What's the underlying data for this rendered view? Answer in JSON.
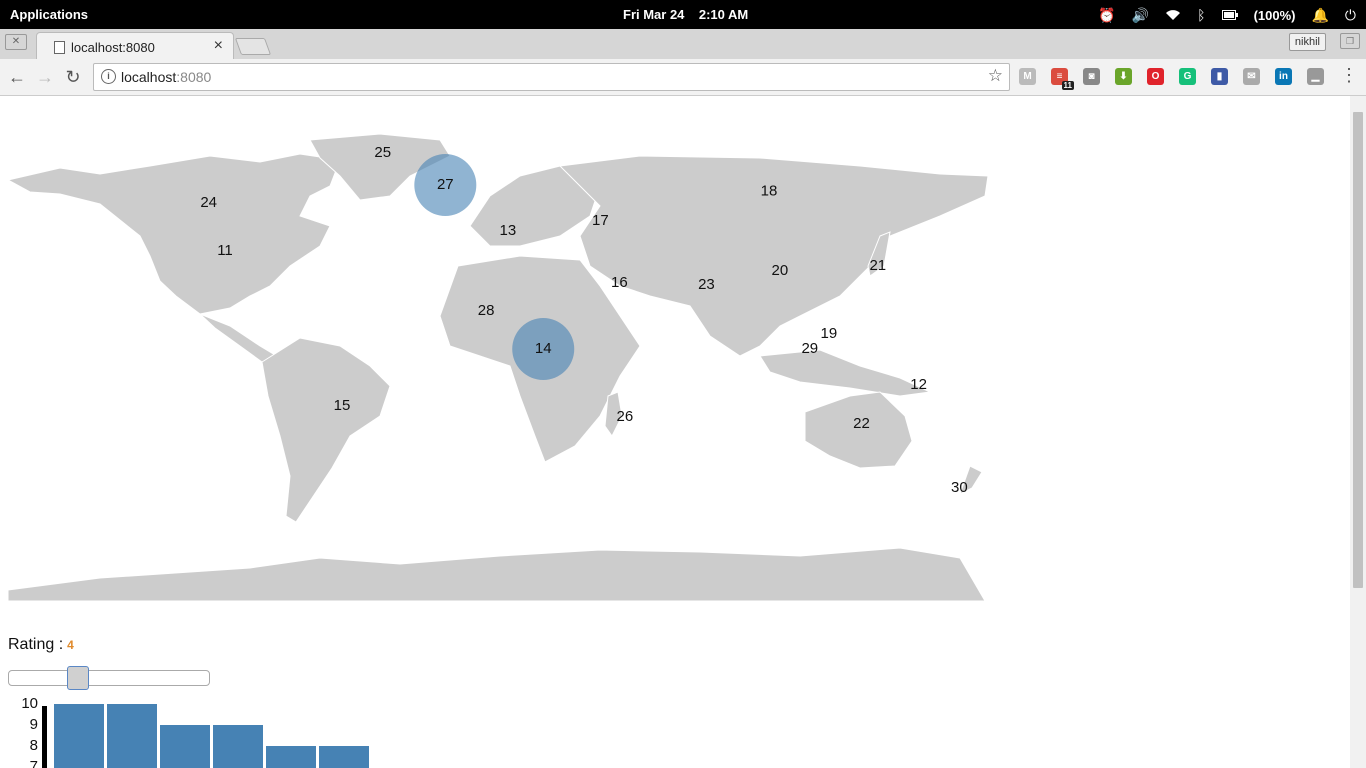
{
  "system_bar": {
    "apps_label": "Applications",
    "clock": "Fri Mar 24    2:10 AM",
    "battery": "(100%)",
    "icons": [
      "alarm-icon",
      "volume-icon",
      "wifi-icon",
      "bluetooth-icon",
      "battery-icon",
      "notification-bell-icon",
      "power-icon"
    ]
  },
  "browser": {
    "tab_title": "localhost:8080",
    "profile_name": "nikhil",
    "url_host": "localhost",
    "url_port": ":8080",
    "extension_badge": "11",
    "extensions": [
      {
        "name": "gmail-extension-icon",
        "color": "#bbbbbb",
        "glyph": "M"
      },
      {
        "name": "todoist-extension-icon",
        "color": "#db4c3f",
        "glyph": "≡"
      },
      {
        "name": "camera-extension-icon",
        "color": "#888888",
        "glyph": "◙"
      },
      {
        "name": "download-extension-icon",
        "color": "#6aa52a",
        "glyph": "⬇"
      },
      {
        "name": "opera-extension-icon",
        "color": "#e0232b",
        "glyph": "O"
      },
      {
        "name": "grammarly-extension-icon",
        "color": "#16c07a",
        "glyph": "G"
      },
      {
        "name": "bookmark-extension-icon",
        "color": "#3e5aa6",
        "glyph": "▮"
      },
      {
        "name": "inbox-extension-icon",
        "color": "#aaaaaa",
        "glyph": "✉"
      },
      {
        "name": "linkedin-extension-icon",
        "color": "#0a77b5",
        "glyph": "in"
      },
      {
        "name": "stats-extension-icon",
        "color": "#999999",
        "glyph": "▁"
      }
    ]
  },
  "map": {
    "land_color": "#cccccc",
    "bubble_color": "#4682b4",
    "labels": [
      {
        "text": "25",
        "lon": -42,
        "lat": 72
      },
      {
        "text": "27",
        "lon": -19,
        "lat": 65
      },
      {
        "text": "24",
        "lon": -106,
        "lat": 57
      },
      {
        "text": "11",
        "lon": -100,
        "lat": 39
      },
      {
        "text": "18",
        "lon": 100,
        "lat": 62
      },
      {
        "text": "17",
        "lon": 38,
        "lat": 53
      },
      {
        "text": "13",
        "lon": 4,
        "lat": 48
      },
      {
        "text": "16",
        "lon": 45,
        "lat": 24
      },
      {
        "text": "23",
        "lon": 77,
        "lat": 21
      },
      {
        "text": "20",
        "lon": 104,
        "lat": 35
      },
      {
        "text": "21",
        "lon": 140,
        "lat": 37
      },
      {
        "text": "28",
        "lon": -4,
        "lat": 17
      },
      {
        "text": "14",
        "lon": 17,
        "lat": 1
      },
      {
        "text": "19",
        "lon": 122,
        "lat": 13
      },
      {
        "text": "29",
        "lon": 115,
        "lat": 1
      },
      {
        "text": "12",
        "lon": 155,
        "lat": -7
      },
      {
        "text": "15",
        "lon": -57,
        "lat": -10
      },
      {
        "text": "26",
        "lon": 47,
        "lat": -19
      },
      {
        "text": "22",
        "lon": 134,
        "lat": -26
      },
      {
        "text": "30",
        "lon": 170,
        "lat": -41
      }
    ],
    "bubbles": [
      {
        "label": "27",
        "lon": -19,
        "lat": 65
      },
      {
        "label": "14",
        "lon": 17,
        "lat": 1
      }
    ]
  },
  "rating": {
    "label": "Rating :",
    "value": "4",
    "slider_fraction": 0.34
  },
  "bar_chart": {
    "ticks": [
      "10",
      "9",
      "8",
      "7"
    ],
    "values": [
      10,
      10,
      9,
      9,
      8,
      8
    ],
    "color": "#4682b4"
  }
}
